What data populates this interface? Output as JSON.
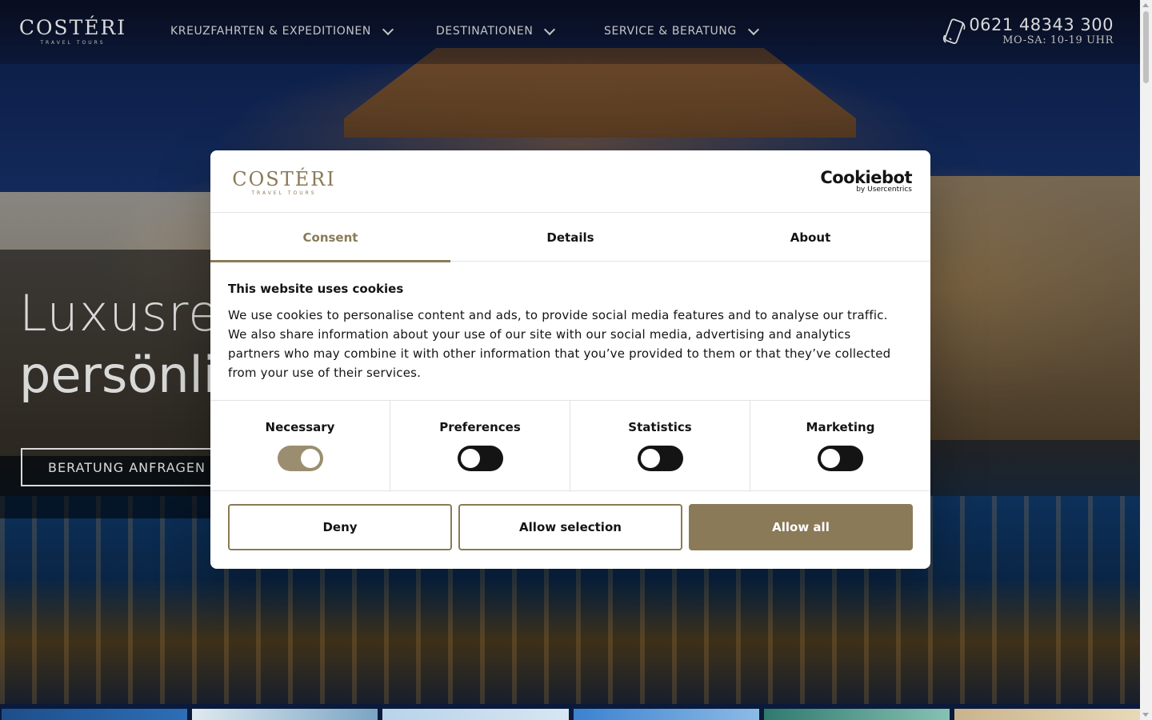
{
  "brand": {
    "name": "COSTÉRI",
    "tagline": "TRAVEL TOURS"
  },
  "nav": {
    "items": [
      {
        "label": "KREUZFAHRTEN & EXPEDITIONEN"
      },
      {
        "label": "DESTINATIONEN"
      },
      {
        "label": "SERVICE & BERATUNG"
      }
    ]
  },
  "contact": {
    "phone": "0621 48343 300",
    "hours": "MO-SA: 10-19 UHR"
  },
  "hero": {
    "line1": "Luxusre",
    "line2": "persönli",
    "cta": "BERATUNG ANFRAGEN"
  },
  "cookie_dialog": {
    "logo": {
      "name": "COSTÉRI",
      "tagline": "TRAVEL TOURS"
    },
    "provider": {
      "name": "Cookiebot",
      "sub": "by Usercentrics"
    },
    "tabs": [
      {
        "label": "Consent",
        "active": true
      },
      {
        "label": "Details",
        "active": false
      },
      {
        "label": "About",
        "active": false
      }
    ],
    "title": "This website uses cookies",
    "text": "We use cookies to personalise content and ads, to provide social media features and to analyse our traffic. We also share information about your use of our site with our social media, advertising and analytics partners who may combine it with other information that you’ve provided to them or that they’ve collected from your use of their services.",
    "categories": [
      {
        "label": "Necessary",
        "enabled": true
      },
      {
        "label": "Preferences",
        "enabled": false
      },
      {
        "label": "Statistics",
        "enabled": false
      },
      {
        "label": "Marketing",
        "enabled": false
      }
    ],
    "buttons": {
      "deny": "Deny",
      "allow_selection": "Allow selection",
      "allow_all": "Allow all"
    }
  },
  "colors": {
    "accent": "#8a7a57",
    "text": "#141414",
    "white": "#ffffff"
  },
  "icons": {
    "phone": "mobile-phone-icon",
    "chevron": "chevron-down-icon"
  }
}
